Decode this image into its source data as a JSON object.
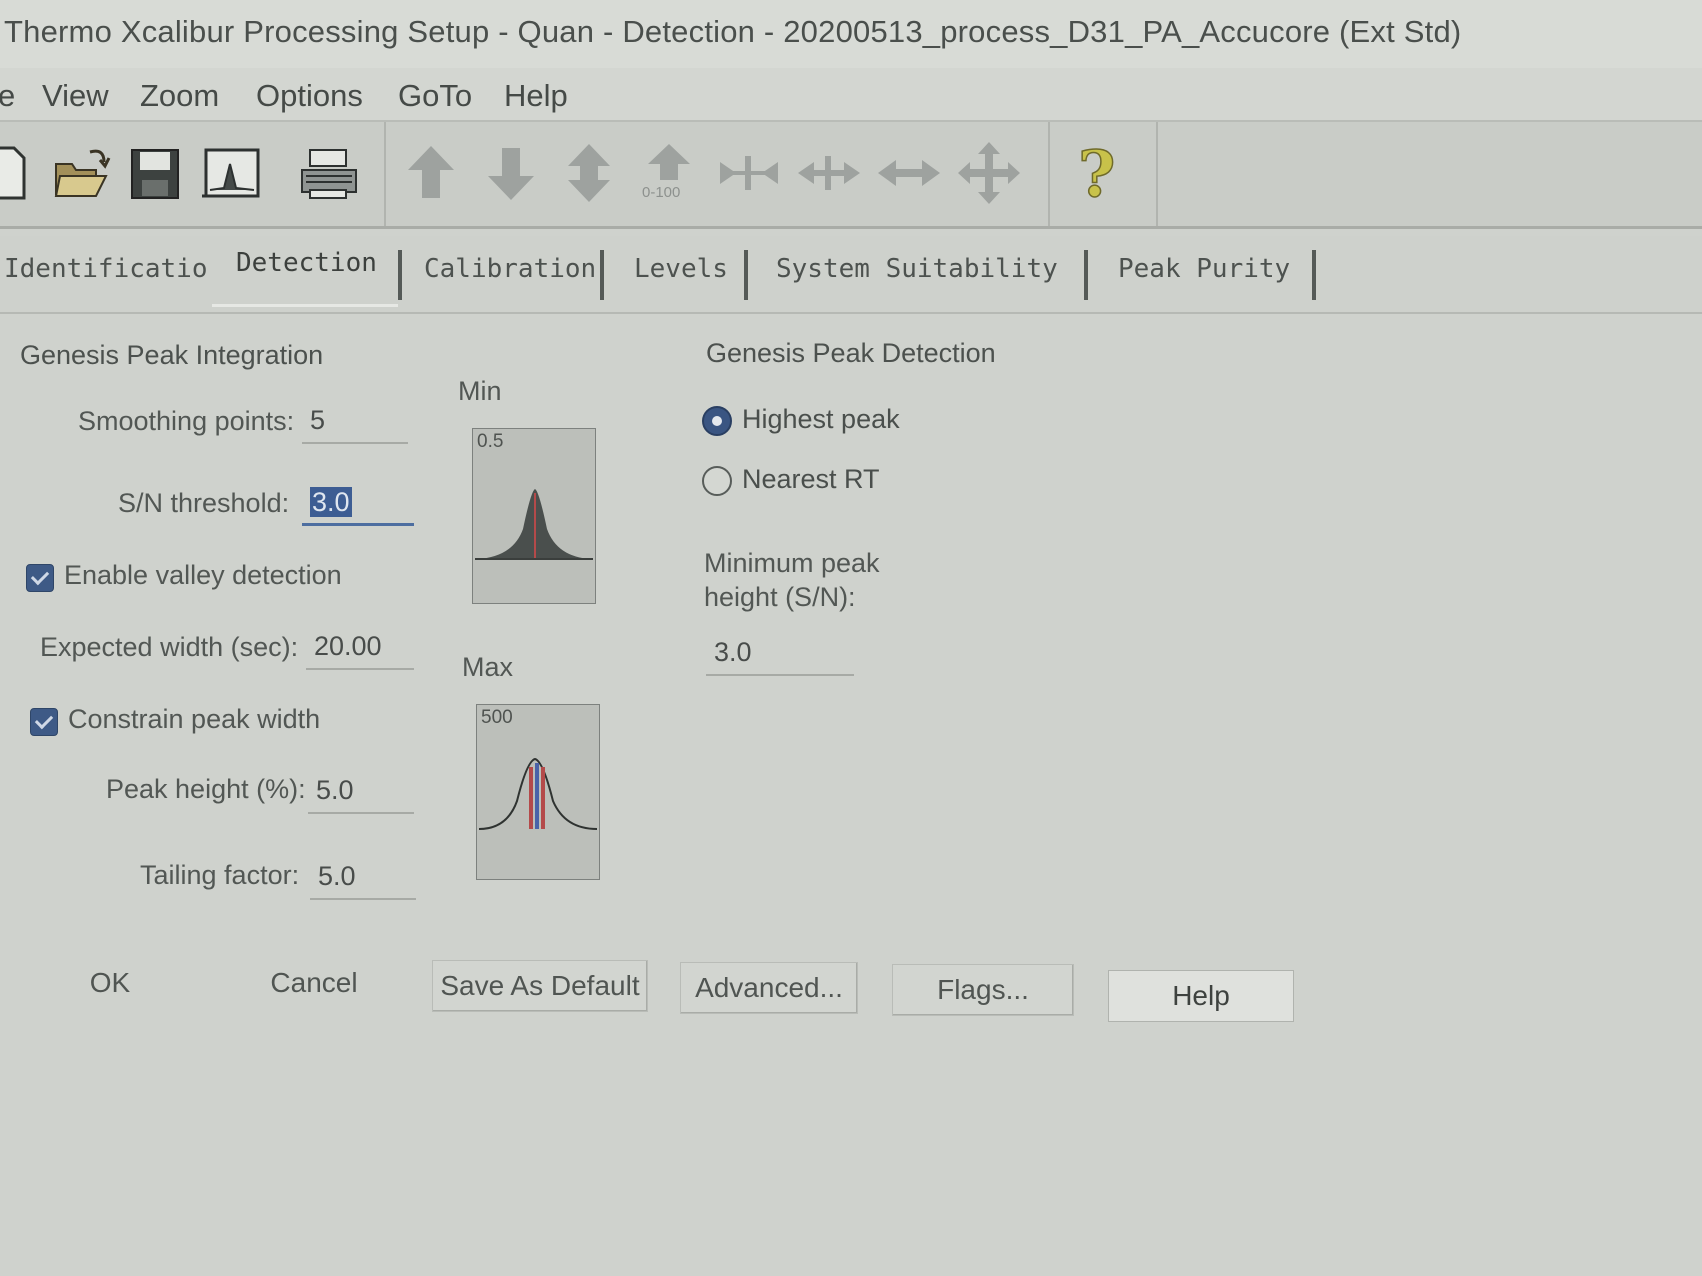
{
  "window": {
    "title": "Thermo Xcalibur Processing Setup  - Quan - Detection - 20200513_process_D31_PA_Accucore (Ext Std)"
  },
  "menu": {
    "items": [
      "e",
      "View",
      "Zoom",
      "Options",
      "GoTo",
      "Help"
    ]
  },
  "toolbar": {
    "buttons": [
      "new-file-icon",
      "open-folder-icon",
      "save-icon",
      "chromatogram-icon",
      "print-icon",
      "arrow-up-icon",
      "arrow-down-icon",
      "arrow-updown-icon",
      "normalize-icon",
      "zoom-in-horizontal-icon",
      "zoom-out-horizontal-icon",
      "stretch-horizontal-icon",
      "move-icon",
      "help-icon"
    ],
    "normalize_label": "0-100"
  },
  "tabs": {
    "items": [
      "Identificatio",
      "Detection",
      "Calibration",
      "Levels",
      "System Suitability",
      "Peak Purity"
    ],
    "active": "Detection"
  },
  "integration": {
    "section_title": "Genesis Peak Integration",
    "smoothing_label": "Smoothing points:",
    "smoothing_value": "5",
    "sn_label": "S/N threshold:",
    "sn_value": "3.0",
    "valley_label": "Enable valley detection",
    "valley_checked": true,
    "expected_width_label": "Expected width (sec):",
    "expected_width_value": "20.00",
    "constrain_label": "Constrain peak width",
    "constrain_checked": true,
    "peak_height_label": "Peak height (%):",
    "peak_height_value": "5.0",
    "tailing_label": "Tailing factor:",
    "tailing_value": "5.0"
  },
  "previews": {
    "min_label": "Min",
    "min_value": "0.5",
    "max_label": "Max",
    "max_value": "500"
  },
  "detection": {
    "section_title": "Genesis Peak Detection",
    "highest_peak_label": "Highest peak",
    "nearest_rt_label": "Nearest RT",
    "selected": "Highest peak",
    "min_height_label_1": "Minimum peak",
    "min_height_label_2": "height (S/N):",
    "min_height_value": "3.0"
  },
  "buttons": {
    "ok": "OK",
    "cancel": "Cancel",
    "save_default": "Save As Default",
    "advanced": "Advanced...",
    "flags": "Flags...",
    "help": "Help"
  },
  "colors": {
    "background": "#cfd2cd",
    "accent": "#3e5a86",
    "help_icon": "#c8c24a"
  }
}
